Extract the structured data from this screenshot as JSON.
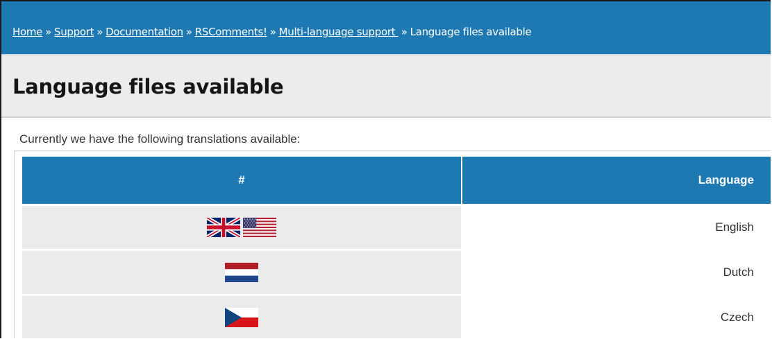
{
  "breadcrumb": {
    "links": [
      {
        "label": "Home"
      },
      {
        "label": "Support"
      },
      {
        "label": "Documentation"
      },
      {
        "label": "RSComments!"
      },
      {
        "label": "Multi-language support "
      }
    ],
    "separator": "»",
    "current": "Language files available"
  },
  "page": {
    "title": "Language files available",
    "intro": "Currently we have the following translations available:"
  },
  "table": {
    "headers": [
      "#",
      "Language"
    ],
    "rows": [
      {
        "language": "English",
        "flags": [
          "uk-flag-icon",
          "us-flag-icon"
        ]
      },
      {
        "language": "Dutch",
        "flags": [
          "netherlands-flag-icon"
        ]
      },
      {
        "language": "Czech",
        "flags": [
          "czech-flag-icon"
        ]
      }
    ]
  },
  "colors": {
    "accent": "#1e79b2",
    "cell_gray": "#ebebeb"
  }
}
